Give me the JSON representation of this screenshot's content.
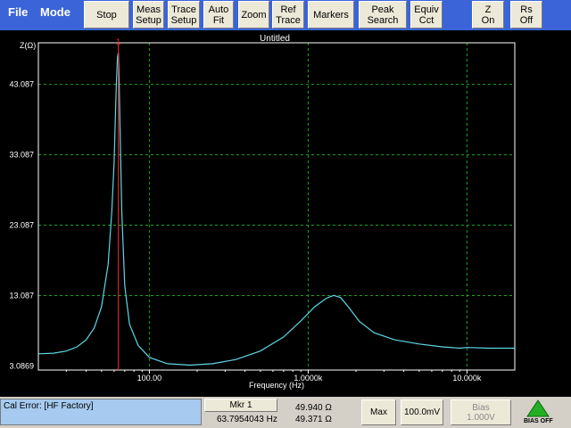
{
  "menus": [
    {
      "label": "File"
    },
    {
      "label": "Mode"
    }
  ],
  "toolbar": [
    {
      "name": "stop-button",
      "label": "Stop"
    },
    {
      "name": "meas-setup-button",
      "label": "Meas\nSetup"
    },
    {
      "name": "trace-setup-button",
      "label": "Trace\nSetup"
    },
    {
      "name": "auto-fit-button",
      "label": "Auto\nFit"
    },
    {
      "name": "zoom-button",
      "label": "Zoom"
    },
    {
      "name": "ref-trace-button",
      "label": "Ref\nTrace"
    },
    {
      "name": "markers-button",
      "label": "Markers"
    },
    {
      "name": "peak-search-button",
      "label": "Peak\nSearch"
    },
    {
      "name": "equiv-cct-button",
      "label": "Equiv\nCct"
    },
    {
      "name": "z-on-button",
      "label": "Z\nOn"
    },
    {
      "name": "rs-off-button",
      "label": "Rs\nOff"
    }
  ],
  "plot": {
    "title": "Untitled",
    "ylabel": "Z(Ω)",
    "xlabel": "Frequency (Hz)",
    "ytick_labels": [
      "43.087",
      "33.087",
      "23.087",
      "13.087",
      "3.0869"
    ],
    "xtick_labels": [
      "100.00",
      "1.0000k",
      "10.000k"
    ],
    "colors": {
      "grid": "#1aa51a",
      "axes": "#ffffff",
      "trace": "#5fd7e6",
      "marker": "#ff2a2a",
      "text": "#ffffff"
    }
  },
  "chart_data": {
    "type": "line",
    "title": "Untitled",
    "xlabel": "Frequency (Hz)",
    "ylabel": "Z(Ω)",
    "xscale": "log",
    "xlim": [
      20,
      20000
    ],
    "ylim": [
      2.5,
      49
    ],
    "grid": true,
    "series": [
      {
        "x": [
          20,
          25,
          30,
          35,
          40,
          45,
          50,
          55,
          58,
          60,
          61,
          62,
          63,
          63.8,
          64.5,
          65.5,
          67,
          70,
          75,
          85,
          100,
          130,
          180,
          250,
          350,
          500,
          700,
          900,
          1100,
          1300,
          1450,
          1600,
          1800,
          2100,
          2600,
          3500,
          5000,
          7000,
          9000,
          10000,
          14000,
          20000
        ],
        "y": [
          4.8,
          4.9,
          5.2,
          5.8,
          6.8,
          8.5,
          11.5,
          17.5,
          25.0,
          32.0,
          38.0,
          43.5,
          47.0,
          47.6,
          44.0,
          36.0,
          25.0,
          14.5,
          9.0,
          6.0,
          4.3,
          3.4,
          3.2,
          3.4,
          4.0,
          5.2,
          7.2,
          9.5,
          11.5,
          12.7,
          13.1,
          12.8,
          11.4,
          9.4,
          7.8,
          6.8,
          6.2,
          5.8,
          5.6,
          5.7,
          5.6,
          5.6
        ]
      }
    ],
    "marker_x": 63.8
  },
  "status": {
    "cal_error": "Cal Error: [HF Factory]",
    "marker_button": "Mkr 1",
    "marker_freq": "63.7954043 Hz",
    "marker_z": "49.940 Ω",
    "marker_rs": "49.371 Ω",
    "max_button": "Max",
    "level_button": "100.0mV",
    "bias_button": "Bias\n1.000V",
    "bias_indicator": "BIAS OFF"
  }
}
